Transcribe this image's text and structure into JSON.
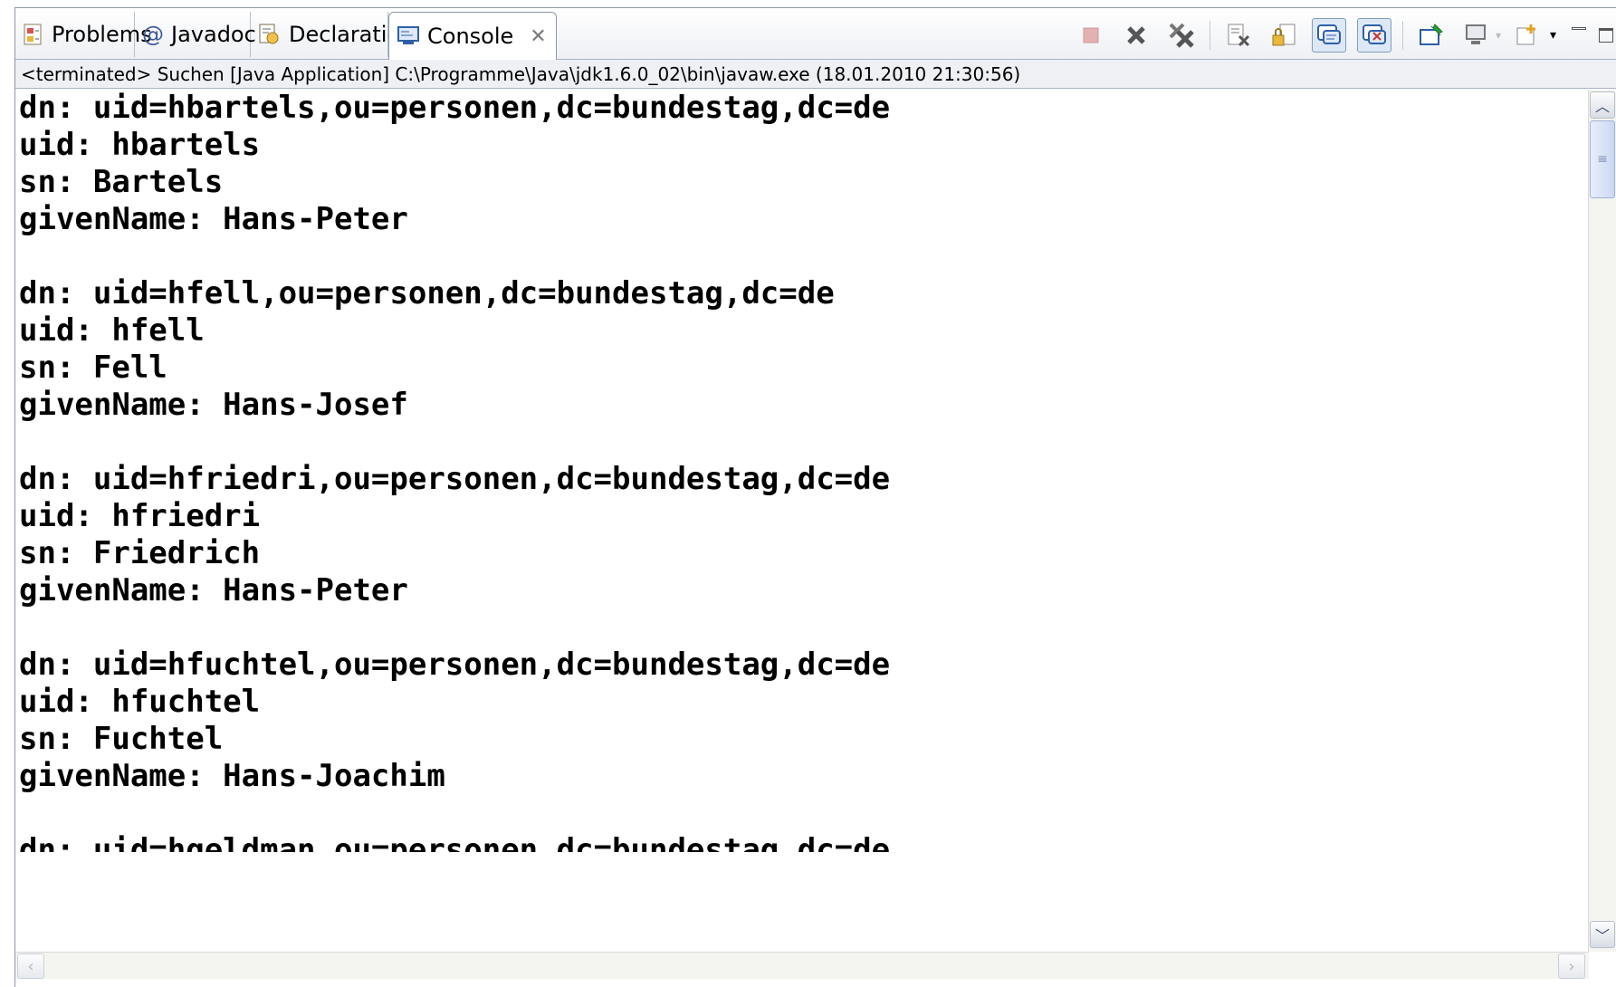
{
  "tabs": [
    {
      "label": "Problems",
      "icon": "problems-icon"
    },
    {
      "label": "Javadoc",
      "icon": "javadoc-icon"
    },
    {
      "label": "Declaration",
      "icon": "declaration-icon"
    },
    {
      "label": "Console",
      "icon": "console-icon",
      "active": true
    }
  ],
  "status_line": "<terminated> Suchen [Java Application] C:\\Programme\\Java\\jdk1.6.0_02\\bin\\javaw.exe (18.01.2010 21:30:56)",
  "console_lines": [
    "dn: uid=hbartels,ou=personen,dc=bundestag,dc=de",
    "uid: hbartels",
    "sn: Bartels",
    "givenName: Hans-Peter",
    "",
    "dn: uid=hfell,ou=personen,dc=bundestag,dc=de",
    "uid: hfell",
    "sn: Fell",
    "givenName: Hans-Josef",
    "",
    "dn: uid=hfriedri,ou=personen,dc=bundestag,dc=de",
    "uid: hfriedri",
    "sn: Friedrich",
    "givenName: Hans-Peter",
    "",
    "dn: uid=hfuchtel,ou=personen,dc=bundestag,dc=de",
    "uid: hfuchtel",
    "sn: Fuchtel",
    "givenName: Hans-Joachim",
    "",
    "dn: uid=hgeldman,ou=personen,dc=bundestag,dc=de"
  ],
  "toolbar_icons": [
    "terminate-icon",
    "remove-launch-icon",
    "remove-all-terminated-icon",
    "clear-console-icon",
    "scroll-lock-icon",
    "show-on-stdout-icon",
    "show-on-stderr-icon",
    "pin-console-icon",
    "display-console-icon",
    "open-console-icon",
    "minimize-icon",
    "maximize-icon"
  ],
  "colors": {
    "accent": "#2e5fa8",
    "border": "#8c97a9",
    "tab_bg": "#eef0f4"
  }
}
